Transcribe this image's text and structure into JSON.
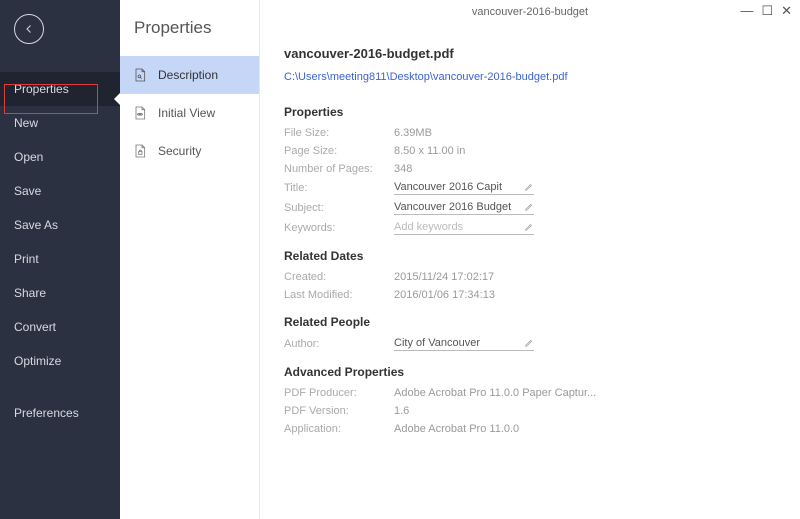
{
  "window": {
    "title": "vancouver-2016-budget"
  },
  "sidebar": {
    "items": [
      {
        "label": "Properties"
      },
      {
        "label": "New"
      },
      {
        "label": "Open"
      },
      {
        "label": "Save"
      },
      {
        "label": "Save As"
      },
      {
        "label": "Print"
      },
      {
        "label": "Share"
      },
      {
        "label": "Convert"
      },
      {
        "label": "Optimize"
      }
    ],
    "pref_label": "Preferences"
  },
  "panel2": {
    "title": "Properties",
    "tabs": [
      {
        "label": "Description"
      },
      {
        "label": "Initial View"
      },
      {
        "label": "Security"
      }
    ]
  },
  "doc": {
    "filename": "vancouver-2016-budget.pdf",
    "path": "C:\\Users\\meeting811\\Desktop\\vancouver-2016-budget.pdf"
  },
  "sections": {
    "properties": {
      "heading": "Properties",
      "file_size_label": "File Size:",
      "file_size": "6.39MB",
      "page_size_label": "Page Size:",
      "page_size": "8.50 x 11.00 in",
      "pages_label": "Number of Pages:",
      "pages": "348",
      "title_label": "Title:",
      "title_value": "Vancouver 2016 Capit",
      "subject_label": "Subject:",
      "subject_value": "Vancouver 2016 Budget",
      "keywords_label": "Keywords:",
      "keywords_placeholder": "Add keywords"
    },
    "dates": {
      "heading": "Related Dates",
      "created_label": "Created:",
      "created": "2015/11/24 17:02:17",
      "modified_label": "Last Modified:",
      "modified": "2016/01/06 17:34:13"
    },
    "people": {
      "heading": "Related People",
      "author_label": "Author:",
      "author_value": "City of Vancouver"
    },
    "advanced": {
      "heading": "Advanced Properties",
      "producer_label": "PDF Producer:",
      "producer": "Adobe Acrobat Pro 11.0.0 Paper Captur...",
      "version_label": "PDF Version:",
      "version": "1.6",
      "app_label": "Application:",
      "app": "Adobe Acrobat Pro 11.0.0"
    }
  }
}
